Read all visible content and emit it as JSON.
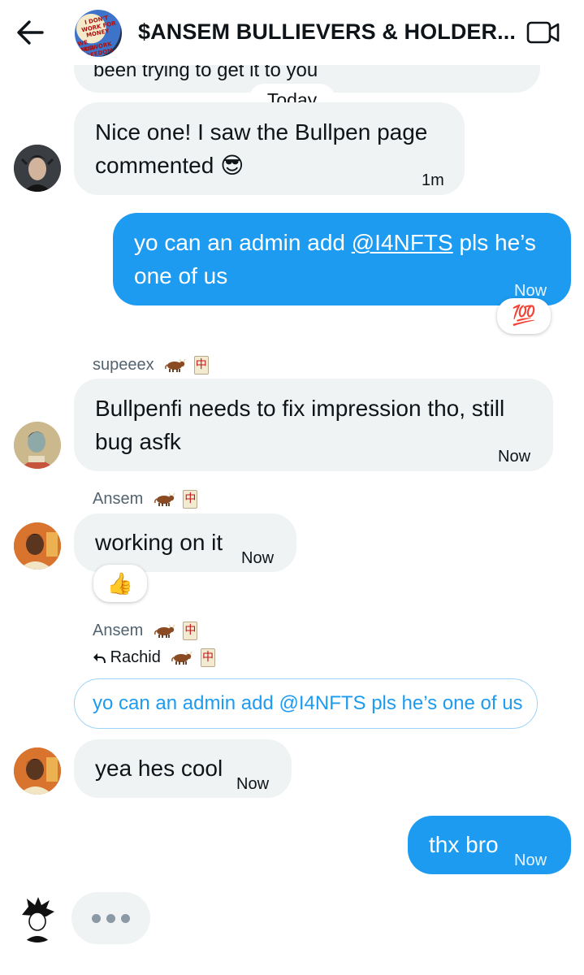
{
  "header": {
    "title": "$ANSEM BULLIEVERS & HOLDER...",
    "back_icon": "arrow-left-icon",
    "video_icon": "video-camera-icon",
    "group_avatar_text": [
      "I DON'T",
      "WORK FOR",
      "MONEY",
      "WE BAGWORK",
      "FOR FREEDOM"
    ]
  },
  "conversation": {
    "previous_snippet": "been trying to get it to you",
    "date_divider": "Today",
    "messages": [
      {
        "line1": "Nice one! I saw the Bullpen page",
        "line2": "commented",
        "emoji": "😎",
        "time": "1m"
      },
      {
        "before_link": "yo can an admin add ",
        "link": "@I4NFTS",
        "after_link": " pls he’s",
        "line2": "one of us",
        "time": "Now",
        "reaction": "💯"
      },
      {
        "sender": "supeeex",
        "line1": "Bullpenfi needs to fix impression tho, still",
        "line2": "bug asfk",
        "time": "Now"
      },
      {
        "sender": "Ansem",
        "text": "working on it",
        "time": "Now",
        "reaction": "👍"
      },
      {
        "sender": "Ansem",
        "reply_to": "Rachid",
        "quoted": "yo can an admin add @I4NFTS pls he’s one of us",
        "text": "yea hes cool",
        "time": "Now"
      },
      {
        "text": "thx bro",
        "time": "Now"
      }
    ],
    "typing_indicator": "typing-dots-icon"
  },
  "sender_badges": {
    "cow_icon": "cow-icon",
    "tile": "中"
  },
  "colors": {
    "accent": "#1d9bf0",
    "incoming_bubble": "#eff3f4",
    "secondary_text": "#536471"
  }
}
